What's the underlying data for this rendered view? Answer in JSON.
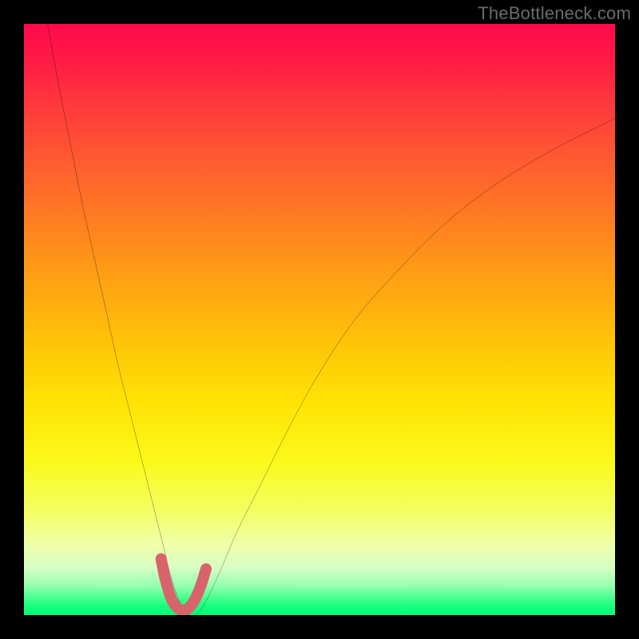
{
  "watermark": "TheBottleneck.com",
  "chart_data": {
    "type": "line",
    "title": "",
    "xlabel": "",
    "ylabel": "",
    "xlim": [
      0,
      100
    ],
    "ylim": [
      0,
      100
    ],
    "background_gradient": {
      "top": "#ff0a4a",
      "bottom": "#00ff76",
      "meaning": "red=high bottleneck, green=low bottleneck"
    },
    "series": [
      {
        "name": "bottleneck-curve",
        "color": "#000000",
        "x": [
          4,
          6,
          8,
          10,
          12,
          14,
          16,
          18,
          20,
          22,
          23.5,
          25,
          26.5,
          28,
          30,
          33,
          36,
          40,
          45,
          50,
          56,
          63,
          71,
          80,
          90,
          100
        ],
        "values": [
          100,
          89,
          79,
          69,
          60,
          51,
          42,
          34,
          26,
          18,
          12,
          6,
          2,
          0,
          1,
          7,
          14,
          22,
          32,
          41,
          50,
          58,
          66,
          73,
          79,
          84
        ]
      },
      {
        "name": "optimal-region-highlight",
        "color": "#d9636b",
        "x": [
          23.2,
          23.8,
          24.5,
          25.2,
          26.0,
          26.8,
          27.6,
          28.4,
          29.2,
          30.0,
          30.8
        ],
        "values": [
          9.5,
          6.5,
          4.0,
          2.2,
          1.2,
          0.8,
          1.0,
          1.8,
          3.2,
          5.2,
          7.8
        ]
      }
    ],
    "notes": "V-shaped bottleneck curve; minimum (balanced) near x≈27. Values estimated from gradient position; axes unlabeled in source."
  }
}
